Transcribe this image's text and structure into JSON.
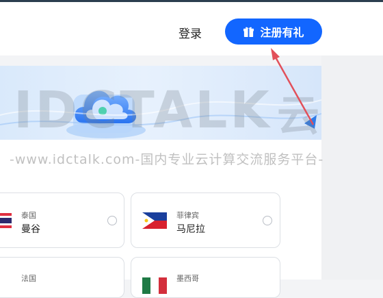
{
  "header": {
    "login_label": "登录",
    "register_label": "注册有礼",
    "icons": {
      "gift": "gift-icon"
    }
  },
  "watermark": {
    "large_latin": "IDCTALK",
    "large_cn": "云说",
    "small": "-www.idctalk.com-国内专业云计算交流服务平台-"
  },
  "regions": [
    {
      "country": "泰国",
      "city": "曼谷",
      "flag": "thailand"
    },
    {
      "country": "菲律宾",
      "city": "马尼拉",
      "flag": "philippines"
    },
    {
      "country": "法国",
      "city": "",
      "flag": "france"
    },
    {
      "country": "墨西哥",
      "city": "",
      "flag": "mexico"
    }
  ],
  "colors": {
    "accent": "#1266ff",
    "arrow": "#e2505a"
  }
}
